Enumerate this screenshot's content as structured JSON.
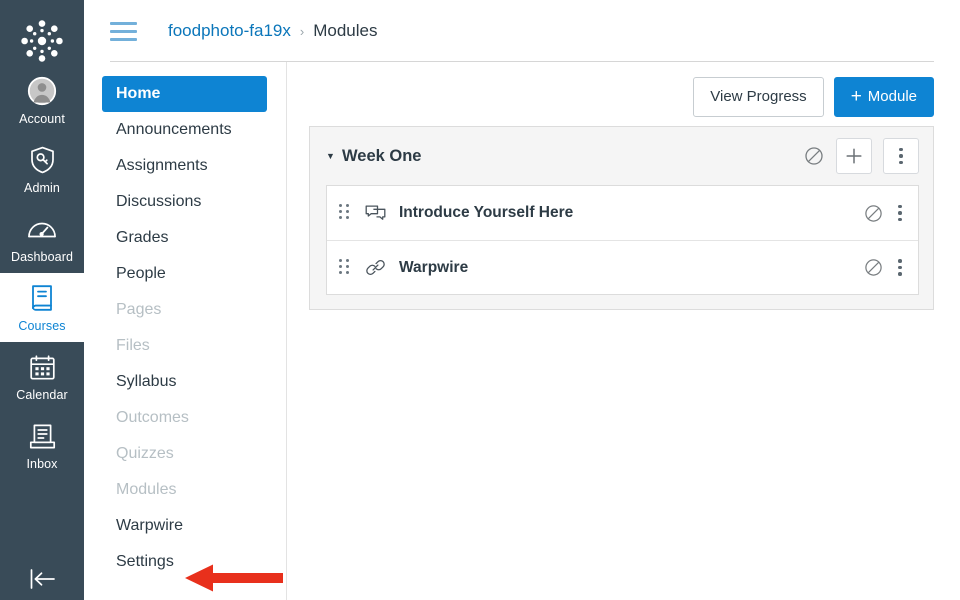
{
  "global_nav": {
    "logo_name": "canvas-logo-icon",
    "items": [
      {
        "label": "Account",
        "icon": "user-avatar-icon",
        "active": false
      },
      {
        "label": "Admin",
        "icon": "shield-key-icon",
        "active": false
      },
      {
        "label": "Dashboard",
        "icon": "dashboard-gauge-icon",
        "active": false
      },
      {
        "label": "Courses",
        "icon": "book-icon",
        "active": true
      },
      {
        "label": "Calendar",
        "icon": "calendar-icon",
        "active": false
      },
      {
        "label": "Inbox",
        "icon": "inbox-tray-icon",
        "active": false
      }
    ],
    "collapse_icon": "collapse-left-icon"
  },
  "header": {
    "menu_icon": "hamburger-menu-icon",
    "breadcrumb": {
      "course": "foodphoto-fa19x",
      "separator": "›",
      "current": "Modules"
    }
  },
  "course_nav": {
    "items": [
      {
        "label": "Home",
        "active": true,
        "disabled": false
      },
      {
        "label": "Announcements",
        "active": false,
        "disabled": false
      },
      {
        "label": "Assignments",
        "active": false,
        "disabled": false
      },
      {
        "label": "Discussions",
        "active": false,
        "disabled": false
      },
      {
        "label": "Grades",
        "active": false,
        "disabled": false
      },
      {
        "label": "People",
        "active": false,
        "disabled": false
      },
      {
        "label": "Pages",
        "active": false,
        "disabled": true
      },
      {
        "label": "Files",
        "active": false,
        "disabled": true
      },
      {
        "label": "Syllabus",
        "active": false,
        "disabled": false
      },
      {
        "label": "Outcomes",
        "active": false,
        "disabled": true
      },
      {
        "label": "Quizzes",
        "active": false,
        "disabled": true
      },
      {
        "label": "Modules",
        "active": false,
        "disabled": true
      },
      {
        "label": "Warpwire",
        "active": false,
        "disabled": false
      },
      {
        "label": "Settings",
        "active": false,
        "disabled": false
      }
    ]
  },
  "toolbar": {
    "view_progress_label": "View Progress",
    "add_module_label": "Module",
    "add_module_plus": "+"
  },
  "module": {
    "caret_icon": "chevron-down-icon",
    "title": "Week One",
    "publish_state_icon": "unpublished-icon",
    "add_item_icon": "plus-icon",
    "menu_icon": "kebab-menu-icon",
    "items": [
      {
        "title": "Introduce Yourself Here",
        "type_icon": "discussion-icon",
        "publish_state_icon": "unpublished-icon",
        "menu_icon": "kebab-menu-icon",
        "drag_icon": "drag-handle-icon"
      },
      {
        "title": "Warpwire",
        "type_icon": "link-icon",
        "publish_state_icon": "unpublished-icon",
        "menu_icon": "kebab-menu-icon",
        "drag_icon": "drag-handle-icon"
      }
    ]
  },
  "annotation": {
    "arrow_icon": "red-arrow-pointing-left",
    "color": "#e8301c",
    "points_at": "Settings"
  },
  "colors": {
    "global_nav_bg": "#394B58",
    "brand_blue": "#0e84d3",
    "link_blue": "#0b76ba",
    "text_dark": "#2d3b45",
    "text_dim": "#b6bfc4",
    "panel_bg": "#f5f5f5",
    "annotation_red": "#e8301c"
  }
}
